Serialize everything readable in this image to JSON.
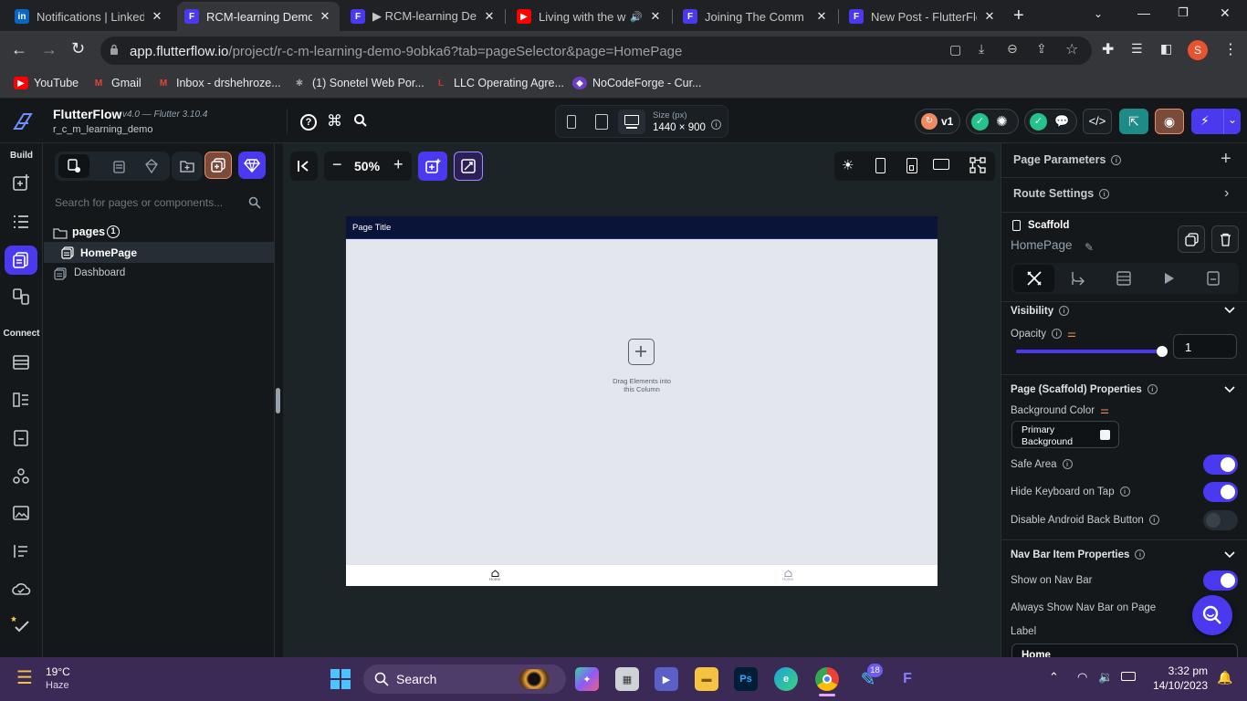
{
  "browser": {
    "tabs": [
      {
        "title": "Notifications | LinkedIn",
        "favicon": "linkedin-icon",
        "color": "#0a66c2"
      },
      {
        "title": "RCM-learning Demo",
        "favicon": "flutterflow-icon",
        "color": "#4b39ef"
      },
      {
        "title": "▶ RCM-learning Demo",
        "favicon": "flutterflow-icon",
        "color": "#4b39ef"
      },
      {
        "title": "Living with the w",
        "favicon": "youtube-icon",
        "color": "#ff0000"
      },
      {
        "title": "Joining The Comm",
        "favicon": "flutterflow-icon",
        "color": "#4b39ef"
      },
      {
        "title": "New Post - FlutterFlow",
        "favicon": "flutterflow-icon",
        "color": "#4b39ef"
      }
    ],
    "url_host": "app.flutterflow.io",
    "url_path": "/project/r-c-m-learning-demo-9obka6?tab=pageSelector&page=HomePage",
    "profile_initial": "S",
    "bookmarks": [
      {
        "label": "YouTube",
        "icon": "youtube-icon"
      },
      {
        "label": "Gmail",
        "icon": "gmail-icon"
      },
      {
        "label": "Inbox - drshehroze...",
        "icon": "gmail-icon"
      },
      {
        "label": "(1) Sonetel Web Por...",
        "icon": "sonetel-icon"
      },
      {
        "label": "LLC Operating Agre...",
        "icon": "llc-icon"
      },
      {
        "label": "NoCodeForge - Cur...",
        "icon": "nocodeforge-icon"
      }
    ]
  },
  "app": {
    "name": "FlutterFlow",
    "version": "v4.0 — Flutter 3.10.4",
    "project": "r_c_m_learning_demo",
    "size_label": "Size (px)",
    "size_value": "1440 × 900",
    "version_badge": "v1"
  },
  "rail": {
    "build_label": "Build",
    "connect_label": "Connect"
  },
  "left_panel": {
    "search_placeholder": "Search for pages or components...",
    "folder_label": "pages",
    "folder_count": "1",
    "pages": [
      "HomePage",
      "Dashboard"
    ]
  },
  "canvas": {
    "zoom": "50%",
    "page_title": "Page Title",
    "drop_hint_1": "Drag Elements into",
    "drop_hint_2": "this Column",
    "nav_items": [
      "Home",
      "Home"
    ]
  },
  "right_panel": {
    "page_parameters": "Page Parameters",
    "route_settings": "Route Settings",
    "widget_type": "Scaffold",
    "widget_name": "HomePage",
    "visibility": "Visibility",
    "opacity_label": "Opacity",
    "opacity_value": "1",
    "opacity_level": 1.0,
    "page_props_title": "Page (Scaffold) Properties",
    "bg_color_label": "Background Color",
    "bg_color_value_1": "Primary",
    "bg_color_value_2": "Background",
    "safe_area": "Safe Area",
    "safe_area_on": true,
    "hide_keyboard": "Hide Keyboard on Tap",
    "hide_keyboard_on": true,
    "disable_back": "Disable Android Back Button",
    "disable_back_on": false,
    "navbar_props_title": "Nav Bar Item Properties",
    "show_on_navbar": "Show on Nav Bar",
    "show_on_navbar_on": true,
    "always_show_navbar": "Always Show Nav Bar on Page",
    "label_label": "Label",
    "label_value": "Home"
  },
  "taskbar": {
    "temperature": "19°C",
    "weather": "Haze",
    "search": "Search",
    "time": "3:32 pm",
    "date": "14/10/2023",
    "badge": "18"
  },
  "colors": {
    "accent": "#4b39ef",
    "bg": "#14181b",
    "canvas": "#1d2428",
    "page_bg": "#e3e6ec",
    "appbar": "#0a1338"
  }
}
